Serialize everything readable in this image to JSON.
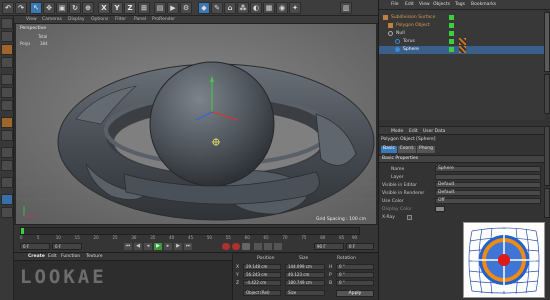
{
  "toolbar": {
    "xyz": [
      "X",
      "Y",
      "Z"
    ]
  },
  "viewport": {
    "menu": [
      "View",
      "Cameras",
      "Display",
      "Options",
      "Filter",
      "Panel",
      "ProRender"
    ],
    "label": "Perspective",
    "stats_total": "Total",
    "stats_polys": "Polys",
    "stats_value": "384",
    "grid_info": "Grid Spacing : 100 cm"
  },
  "timeline": {
    "ticks": [
      "0",
      "5",
      "10",
      "15",
      "20",
      "25",
      "30",
      "35",
      "40",
      "45",
      "50",
      "55",
      "60",
      "65",
      "70",
      "75",
      "80",
      "85",
      "90"
    ],
    "start_field": "0 F",
    "end_field": "90 F",
    "current_field": "0 F",
    "end_frame": "0 F"
  },
  "bottom": {
    "menu": [
      "Create",
      "Edit",
      "Function",
      "Texture"
    ],
    "watermark": "LOOKAE"
  },
  "coords": {
    "headers": [
      "Position",
      "Size",
      "Rotation"
    ],
    "axes": [
      "X",
      "Y",
      "Z"
    ],
    "position": [
      "29.148 cm",
      "56.243 cm",
      "-4.422 cm"
    ],
    "size": [
      "144.099 cm",
      "40.123 cm",
      "180.749 cm"
    ],
    "rotation": [
      "H",
      "P",
      "B"
    ],
    "rotation_values": [
      "0 °",
      "0 °",
      "0 °"
    ],
    "mode_select": "Object (Rel)",
    "size_select": "Size",
    "apply": "Apply"
  },
  "right": {
    "menu": [
      "File",
      "Edit",
      "View",
      "Objects",
      "Tags",
      "Bookmarks"
    ],
    "objects": [
      {
        "name": "Subdivision Surface",
        "indent": 0,
        "color": "#c08040"
      },
      {
        "name": "Polygon Object",
        "indent": 1,
        "color": "#c08040"
      },
      {
        "name": "Null",
        "indent": 1,
        "color": "#d0d0d0"
      },
      {
        "name": "Torus",
        "indent": 2,
        "color": "#d0d0d0"
      },
      {
        "name": "Sphere",
        "indent": 2,
        "color": "#d0d0d0"
      }
    ],
    "attr_menu": [
      "Mode",
      "Edit",
      "User Data"
    ],
    "attr_title": "Polygon Object [Sphere]",
    "attr_tabs": [
      "Basic",
      "Coord.",
      "Phong"
    ],
    "section": "Basic Properties",
    "props": [
      {
        "label": "Name",
        "value": "Sphere"
      },
      {
        "label": "Layer",
        "value": ""
      },
      {
        "label": "Visible in Editor",
        "value": "Default"
      },
      {
        "label": "Visible in Renderer",
        "value": "Default"
      },
      {
        "label": "Use Color",
        "value": "Off"
      },
      {
        "label": "Display Color",
        "value": ""
      },
      {
        "label": "X-Ray",
        "value": ""
      }
    ]
  },
  "colors": {
    "accent_blue": "#3a78b8",
    "accent_orange": "#e08a20",
    "selection": "#3a5f8a"
  }
}
